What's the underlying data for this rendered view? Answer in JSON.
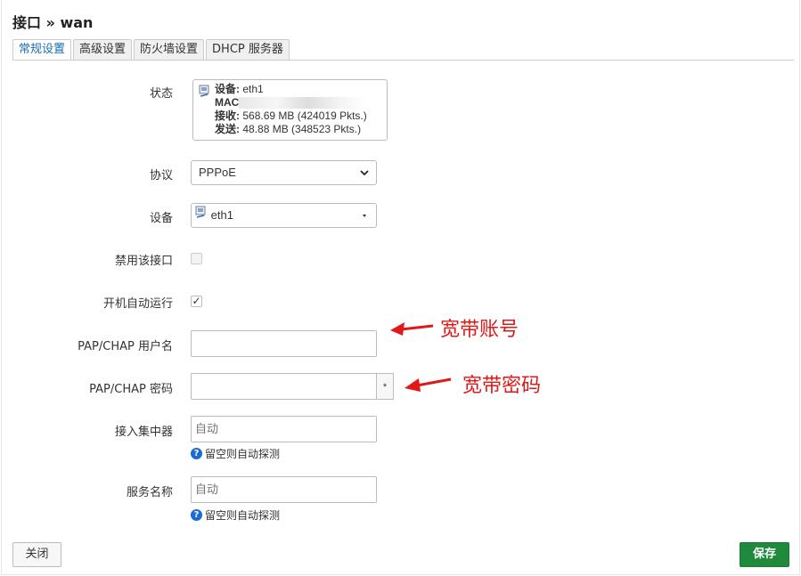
{
  "header": {
    "title": "接口 » wan"
  },
  "tabs": [
    {
      "label": "常规设置"
    },
    {
      "label": "高级设置"
    },
    {
      "label": "防火墙设置"
    },
    {
      "label": "DHCP 服务器"
    }
  ],
  "form": {
    "status": {
      "label": "状态",
      "device_key": "设备:",
      "device_val": "eth1",
      "mac_key": "MAC",
      "rx_key": "接收:",
      "rx_val": "568.69 MB (424019 Pkts.)",
      "tx_key": "发送:",
      "tx_val": "48.88 MB (348523 Pkts.)"
    },
    "protocol": {
      "label": "协议",
      "value": "PPPoE"
    },
    "device": {
      "label": "设备",
      "value": "eth1"
    },
    "disable_iface": {
      "label": "禁用该接口",
      "checked": false
    },
    "autostart": {
      "label": "开机自动运行",
      "checked": true,
      "mark": "✓"
    },
    "username": {
      "label": "PAP/CHAP 用户名",
      "value": ""
    },
    "password": {
      "label": "PAP/CHAP 密码",
      "value": "",
      "reveal": "*"
    },
    "ac": {
      "label": "接入集中器",
      "placeholder": "自动",
      "hint": "留空则自动探测"
    },
    "service": {
      "label": "服务名称",
      "placeholder": "自动",
      "hint": "留空则自动探测"
    }
  },
  "annotations": {
    "username_note": "宽带账号",
    "password_note": "宽带密码"
  },
  "footer": {
    "close_label": "关闭",
    "save_label": "保存"
  },
  "colors": {
    "accent": "#1e6db0",
    "save": "#1f8a3c",
    "annotation": "#e01818"
  }
}
